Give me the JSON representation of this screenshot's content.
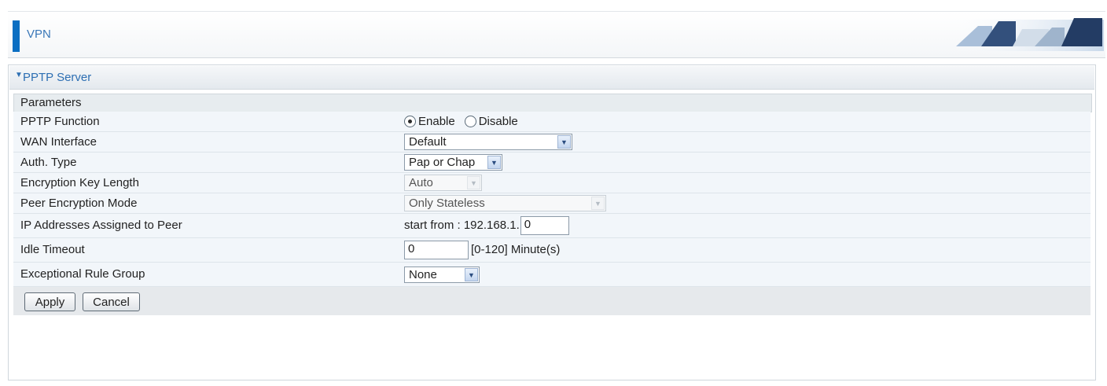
{
  "header": {
    "title": "VPN"
  },
  "section": {
    "title": "PPTP Server",
    "subheader": "Parameters"
  },
  "rows": {
    "pptp_function": {
      "label": "PPTP Function",
      "options": [
        {
          "label": "Enable",
          "selected": true
        },
        {
          "label": "Disable",
          "selected": false
        }
      ]
    },
    "wan_interface": {
      "label": "WAN Interface",
      "value": "Default"
    },
    "auth_type": {
      "label": "Auth. Type",
      "value": "Pap or Chap"
    },
    "encryption_key_length": {
      "label": "Encryption Key Length",
      "value": "Auto"
    },
    "peer_encryption_mode": {
      "label": "Peer Encryption Mode",
      "value": "Only Stateless"
    },
    "ip_addresses": {
      "label": "IP Addresses Assigned to Peer",
      "prefix": "start from : 192.168.1.",
      "value": "0"
    },
    "idle_timeout": {
      "label": "Idle Timeout",
      "value": "0",
      "suffix": "[0-120] Minute(s)"
    },
    "exceptional_rule_group": {
      "label": "Exceptional Rule Group",
      "value": "None"
    }
  },
  "buttons": {
    "apply": "Apply",
    "cancel": "Cancel"
  },
  "colors": {
    "accent": "#0a6ec2",
    "title_text": "#3a78b8",
    "row_bg": "#f2f6fa",
    "button_bar": "#e6e9ec"
  }
}
